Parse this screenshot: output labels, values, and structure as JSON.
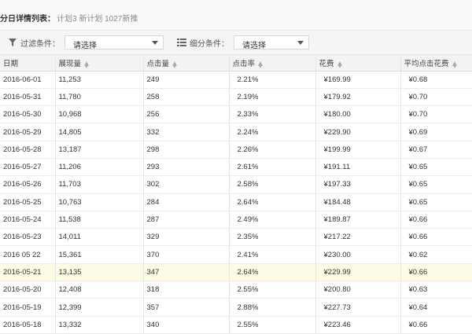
{
  "header": {
    "title": "分日详情列表：",
    "subtitle": "计划3 新计划 1027新推"
  },
  "filters": {
    "filter_label": "过滤条件：",
    "filter_value": "请选择",
    "segment_label": "细分条件：",
    "segment_value": "请选择"
  },
  "table": {
    "columns": [
      "日期",
      "展现量",
      "点击量",
      "点击率",
      "花费",
      "平均点击花费"
    ],
    "sortable": [
      false,
      true,
      true,
      true,
      true,
      true
    ],
    "rows": [
      [
        "2016-06-01",
        "11,253",
        "249",
        "2.21%",
        "¥169.99",
        "¥0.68"
      ],
      [
        "2016-05-31",
        "11,780",
        "258",
        "2.19%",
        "¥179.92",
        "¥0.70"
      ],
      [
        "2016-05-30",
        "10,968",
        "256",
        "2.33%",
        "¥180.00",
        "¥0.70"
      ],
      [
        "2016-05-29",
        "14,805",
        "332",
        "2.24%",
        "¥229.90",
        "¥0.69"
      ],
      [
        "2016-05-28",
        "13,187",
        "298",
        "2.26%",
        "¥199.99",
        "¥0.67"
      ],
      [
        "2016-05-27",
        "11,206",
        "293",
        "2.61%",
        "¥191.11",
        "¥0.65"
      ],
      [
        "2016-05-26",
        "11,703",
        "302",
        "2.58%",
        "¥197.33",
        "¥0.65"
      ],
      [
        "2016-05-25",
        "10,763",
        "284",
        "2.64%",
        "¥184.48",
        "¥0.65"
      ],
      [
        "2016-05-24",
        "11,538",
        "287",
        "2.49%",
        "¥189.87",
        "¥0.66"
      ],
      [
        "2016-05-23",
        "14,011",
        "329",
        "2.35%",
        "¥217.22",
        "¥0.66"
      ],
      [
        "2016 05 22",
        "15,361",
        "370",
        "2.41%",
        "¥230.00",
        "¥0.62"
      ],
      [
        "2016-05-21",
        "13,135",
        "347",
        "2.64%",
        "¥229.99",
        "¥0.66"
      ],
      [
        "2016-05-20",
        "12,408",
        "318",
        "2.55%",
        "¥200.80",
        "¥0.63"
      ],
      [
        "2016-05-19",
        "12,399",
        "357",
        "2.88%",
        "¥227.73",
        "¥0.64"
      ],
      [
        "2016-05-18",
        "13,332",
        "340",
        "2.55%",
        "¥223.46",
        "¥0.66"
      ]
    ],
    "highlighted_row": 11
  }
}
